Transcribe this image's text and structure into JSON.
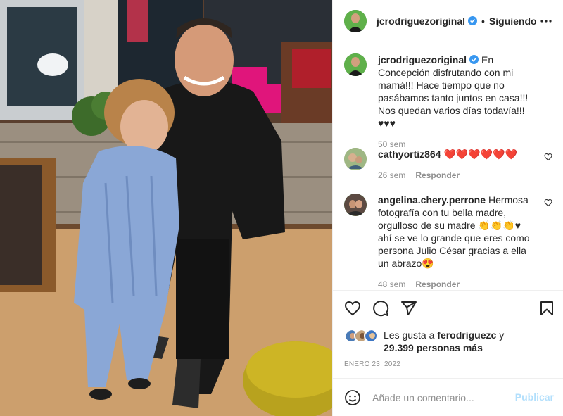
{
  "header": {
    "username": "jcrodriguezoriginal",
    "separator": "•",
    "follow_status": "Siguiendo"
  },
  "caption": {
    "username": "jcrodriguezoriginal",
    "text": "En Concepción disfrutando con mi mamá!!! Hace tiempo que no pasábamos tanto juntos en casa!!! Nos quedan varios días todavía!!! ♥♥♥",
    "time": "50 sem"
  },
  "comments": [
    {
      "username": "cathyortiz864",
      "text": "❤️❤️❤️❤️❤️❤️",
      "time": "26 sem",
      "reply_label": "Responder"
    },
    {
      "username": "angelina.chery.perrone",
      "text": "Hermosa fotografía con tu bella madre, orgulloso de su madre 👏👏👏♥ ahí se ve lo grande que eres como persona Julio César gracias a ella un abrazo😍",
      "time": "48 sem",
      "reply_label": "Responder"
    }
  ],
  "likes": {
    "prefix": "Les gusta a",
    "first_user": "ferodriguezc",
    "connector": "y",
    "others": "29.399 personas más"
  },
  "post_date": "ENERO 23, 2022",
  "add_comment": {
    "placeholder": "Añade un comentario...",
    "publish_label": "Publicar"
  },
  "icons": {
    "more": "more-options-icon",
    "like": "heart-icon",
    "comment": "comment-icon",
    "share": "share-icon",
    "save": "bookmark-icon",
    "emoji": "emoji-icon",
    "verified": "verified-badge-icon"
  },
  "colors": {
    "verified": "#3897f0",
    "publish_disabled": "#b2dffc",
    "secondary_text": "#8e8e8e",
    "emoji_heart": "#ed1c24"
  }
}
